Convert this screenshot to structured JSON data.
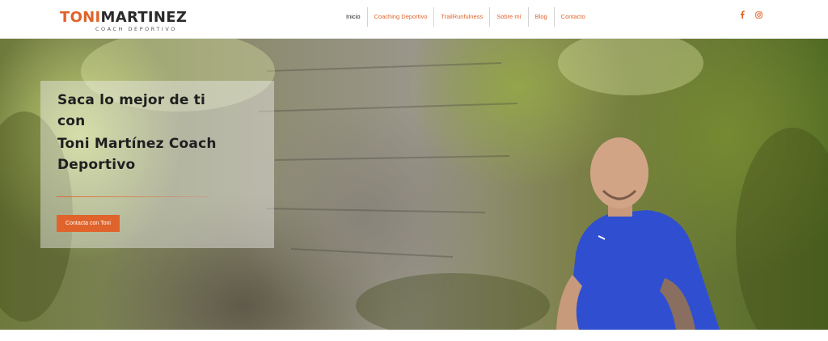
{
  "header": {
    "logo": {
      "first": "TONI",
      "last": "MARTINEZ",
      "subtitle": "COACH DEPORTIVO"
    },
    "nav": [
      {
        "label": "Inicio",
        "active": true
      },
      {
        "label": "Coaching Deportivo",
        "active": false
      },
      {
        "label": "TrailRunfulness",
        "active": false
      },
      {
        "label": "Sobre mí",
        "active": false
      },
      {
        "label": "Blog",
        "active": false
      },
      {
        "label": "Contacto",
        "active": false
      }
    ],
    "social": [
      {
        "icon": "facebook-icon"
      },
      {
        "icon": "instagram-icon"
      }
    ]
  },
  "hero": {
    "title_line1": "Saca lo mejor de ti",
    "title_line2": "con",
    "title_line3": "Toni Martínez Coach",
    "title_line4": "Deportivo",
    "cta_label": "Contacta con Toni"
  },
  "colors": {
    "accent": "#e0632b",
    "dark_text": "#1f1f1f",
    "shirt": "#2f4fd0"
  }
}
